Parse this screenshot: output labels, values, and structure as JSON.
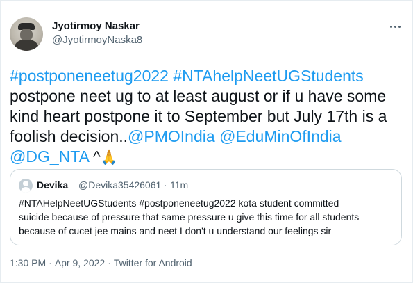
{
  "author": {
    "display_name": "Jyotirmoy Naskar",
    "handle": "@JyotirmoyNaska8"
  },
  "menu_icon": "more-horizontal-icon",
  "tweet": {
    "line1_tag1": "#postponeneetug2022",
    "line1_tag2": "#NTAhelpNeetUGStudents",
    "line2": "postpone neet ug to at least august or if u have some",
    "line3": "kind heart postpone it to September but July 17th is a",
    "line4_text": "foolish decision..",
    "line4_mention1": "@PMOIndia",
    "line4_mention2": "@EduMinOfIndia",
    "line5_mention": "@DG_NTA",
    "line5_text": " ^",
    "emoji": "🙏",
    "emoji_icon": "folded-hands-icon"
  },
  "quoted": {
    "display_name": "Devika",
    "handle": "@Devika35426061",
    "separator": "·",
    "time": "11m",
    "line1": "#NTAHelpNeetUGStudents #postponeneetug2022 kota student committed",
    "line2": "suicide because of pressure that same pressure u give this time for all students",
    "line3": "because of cucet jee mains and neet I don't u understand our feelings sir"
  },
  "meta": {
    "time": "1:30 PM",
    "separator": "·",
    "date": "Apr 9, 2022",
    "source": "Twitter for Android"
  },
  "colors": {
    "link": "#1d9bf0",
    "secondary_text": "#536471",
    "primary_text": "#0f1419",
    "border": "#cfd9de"
  }
}
